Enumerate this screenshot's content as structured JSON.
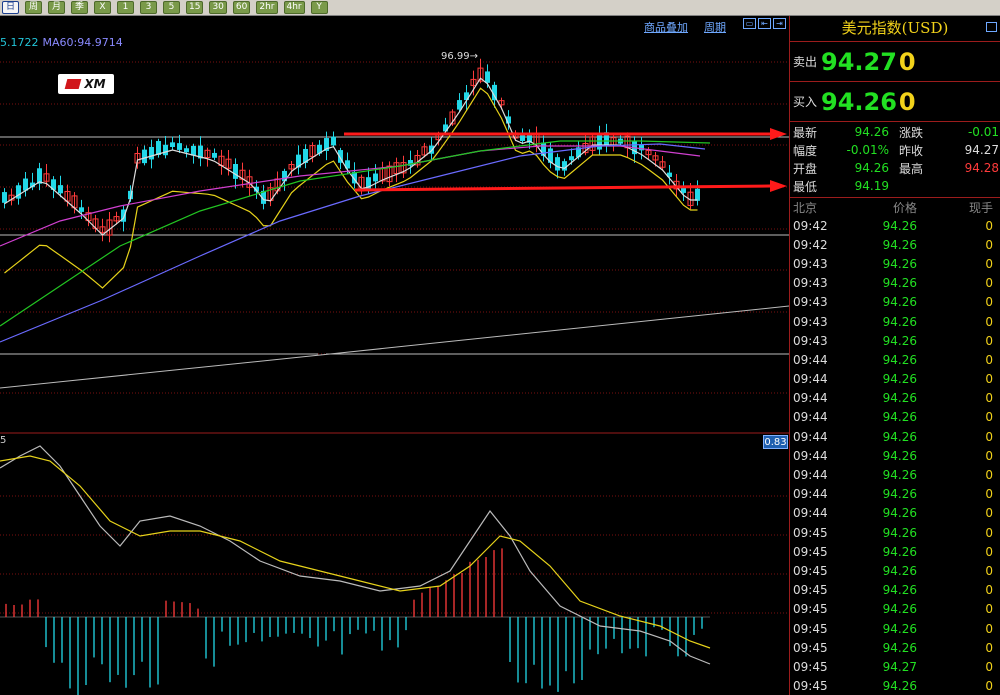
{
  "toolbar": {
    "buttons": [
      {
        "label": "日",
        "active": true
      },
      {
        "label": "周"
      },
      {
        "label": "月"
      },
      {
        "label": "季"
      },
      {
        "label": "X"
      },
      {
        "label": "1"
      },
      {
        "label": "3"
      },
      {
        "label": "5"
      },
      {
        "label": "15"
      },
      {
        "label": "30"
      },
      {
        "label": "60"
      },
      {
        "label": "2hr"
      },
      {
        "label": "4hr"
      },
      {
        "label": "Y"
      }
    ]
  },
  "chart_header": {
    "overlay_link": "商品叠加",
    "period_link": "周期",
    "ma_legend": [
      {
        "text": "5.1722",
        "color": "#22c4d8"
      },
      {
        "text": "MA60:94.9714",
        "color": "#8a8aff"
      }
    ],
    "logo_text": "XM",
    "peak_label": "96.99→"
  },
  "macd_panel": {
    "left_label": "5",
    "value_badge": "0.83"
  },
  "quote": {
    "title": "美元指数(USD)",
    "sell_label": "卖出",
    "sell_price": "94.27",
    "sell_volume": "0",
    "buy_label": "买入",
    "buy_price": "94.26",
    "buy_volume": "0",
    "stats": [
      {
        "k": "最新",
        "v": "94.26",
        "vcolor": "#22e022",
        "k2": "涨跌",
        "v2": "-0.01",
        "v2color": "#22e022"
      },
      {
        "k": "幅度",
        "v": "-0.01%",
        "vcolor": "#22e022",
        "k2": "昨收",
        "v2": "94.27",
        "v2color": "#dddddd"
      },
      {
        "k": "开盘",
        "v": "94.26",
        "vcolor": "#22e022",
        "k2": "最高",
        "v2": "94.28",
        "v2color": "#ff3b3b"
      },
      {
        "k": "最低",
        "v": "94.19",
        "vcolor": "#22e022",
        "k2": "",
        "v2": "",
        "v2color": "#dddddd"
      }
    ],
    "ticks_header": {
      "time": "北京",
      "price": "价格",
      "volume": "现手"
    },
    "ticks": [
      {
        "t": "09:42",
        "p": "94.26",
        "v": "0"
      },
      {
        "t": "09:42",
        "p": "94.26",
        "v": "0"
      },
      {
        "t": "09:43",
        "p": "94.26",
        "v": "0"
      },
      {
        "t": "09:43",
        "p": "94.26",
        "v": "0"
      },
      {
        "t": "09:43",
        "p": "94.26",
        "v": "0"
      },
      {
        "t": "09:43",
        "p": "94.26",
        "v": "0"
      },
      {
        "t": "09:43",
        "p": "94.26",
        "v": "0"
      },
      {
        "t": "09:44",
        "p": "94.26",
        "v": "0"
      },
      {
        "t": "09:44",
        "p": "94.26",
        "v": "0"
      },
      {
        "t": "09:44",
        "p": "94.26",
        "v": "0"
      },
      {
        "t": "09:44",
        "p": "94.26",
        "v": "0"
      },
      {
        "t": "09:44",
        "p": "94.26",
        "v": "0"
      },
      {
        "t": "09:44",
        "p": "94.26",
        "v": "0"
      },
      {
        "t": "09:44",
        "p": "94.26",
        "v": "0"
      },
      {
        "t": "09:44",
        "p": "94.26",
        "v": "0"
      },
      {
        "t": "09:44",
        "p": "94.26",
        "v": "0"
      },
      {
        "t": "09:45",
        "p": "94.26",
        "v": "0"
      },
      {
        "t": "09:45",
        "p": "94.26",
        "v": "0"
      },
      {
        "t": "09:45",
        "p": "94.26",
        "v": "0"
      },
      {
        "t": "09:45",
        "p": "94.26",
        "v": "0"
      },
      {
        "t": "09:45",
        "p": "94.26",
        "v": "0"
      },
      {
        "t": "09:45",
        "p": "94.26",
        "v": "0"
      },
      {
        "t": "09:45",
        "p": "94.26",
        "v": "0"
      },
      {
        "t": "09:45",
        "p": "94.27",
        "v": "0"
      },
      {
        "t": "09:45",
        "p": "94.26",
        "v": "0"
      }
    ]
  },
  "colors": {
    "up_candle": "#ff3b3b",
    "down_candle": "#22d8e8",
    "grid": "#7a1010",
    "arrow": "#ff1a1a",
    "ma_short": "#dddddd",
    "ma_mid": "#e6d21a",
    "ma_long1": "#d040d0",
    "ma_long2": "#22c422",
    "ma_long3": "#6a6aff"
  }
}
